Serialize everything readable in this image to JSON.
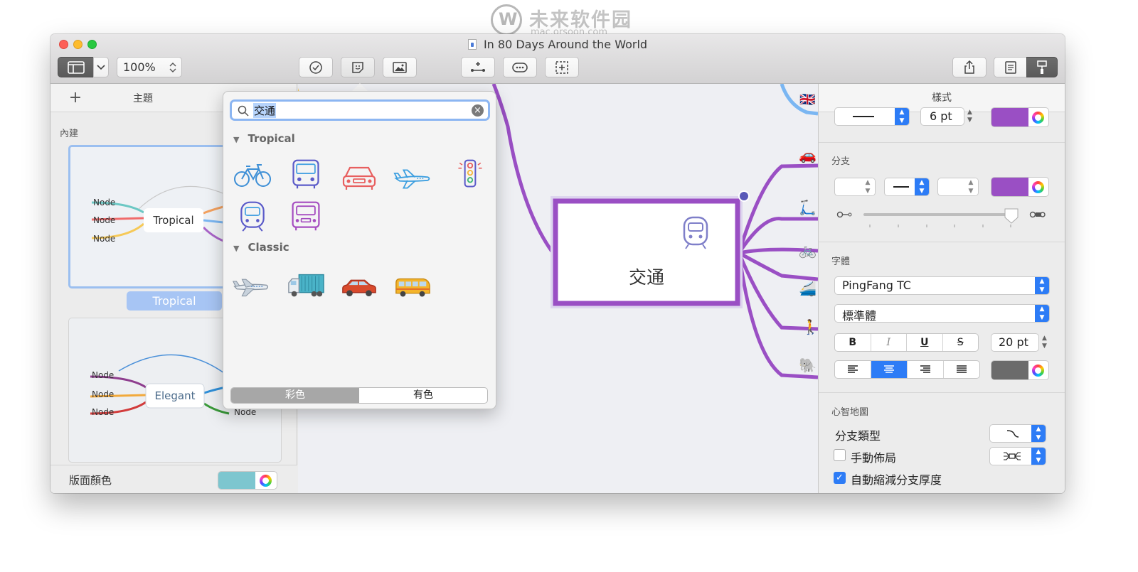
{
  "watermark": {
    "text": "未来软件园",
    "url_text": "mac.orsoon.com"
  },
  "window": {
    "title": "In 80 Days Around the World"
  },
  "toolbar": {
    "zoom": "100%"
  },
  "left_panel": {
    "tab_title": "主題",
    "section_label": "內建",
    "themes": [
      {
        "name": "Tropical",
        "center": "Tropical",
        "nodes": [
          "Node",
          "Node",
          "Node"
        ],
        "selected": true
      },
      {
        "name": "Elegant",
        "center": "Elegant",
        "nodes": [
          "Node",
          "Node",
          "Node",
          "Node"
        ],
        "selected": false
      }
    ],
    "footer_label": "版面顏色",
    "footer_color": "#7dc6cf"
  },
  "canvas": {
    "central_topic": "交通",
    "accent_color": "#9a4fc4",
    "branch_emojis": [
      "🇬🇧",
      "🚗",
      "🛴",
      "🚲",
      "🚄",
      "🚶",
      "🐘"
    ]
  },
  "popover": {
    "search_value": "交通",
    "groups": [
      {
        "title": "Tropical",
        "icons": [
          "bicycle-icon",
          "bus-icon",
          "car-icon",
          "airplane-icon",
          "traffic-light-icon",
          "train-icon",
          "truck-icon"
        ]
      },
      {
        "title": "Classic",
        "icons": [
          "airplane-icon",
          "truck-icon",
          "car-icon",
          "van-icon"
        ]
      }
    ],
    "segments": [
      "彩色",
      "有色"
    ],
    "active_segment": 0
  },
  "right_panel": {
    "tab_title": "樣式",
    "line_width": "6 pt",
    "line_color": "#9a4fc4",
    "branch_label": "分支",
    "branch_color": "#9a4fc4",
    "font_label": "字體",
    "font_family": "PingFang TC",
    "font_style": "標準體",
    "format_buttons": [
      "B",
      "I",
      "U",
      "S"
    ],
    "font_size": "20 pt",
    "text_color": "#6b6b6b",
    "mindmap_label": "心智地圖",
    "branch_type_label": "分支類型",
    "manual_layout_label": "手動佈局",
    "auto_reduce_label": "自動縮減分支厚度",
    "manual_layout_checked": false,
    "auto_reduce_checked": true
  }
}
